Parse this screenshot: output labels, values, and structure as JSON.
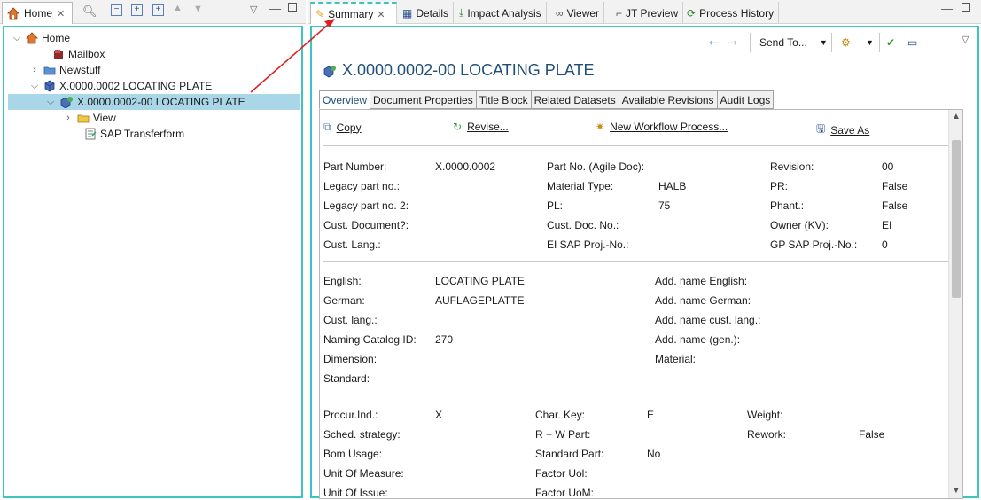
{
  "left_panel": {
    "tab_label": "Home",
    "tree": [
      {
        "label": "Home"
      },
      {
        "label": "Mailbox"
      },
      {
        "label": "Newstuff"
      },
      {
        "label": "X.0000.0002 LOCATING PLATE"
      },
      {
        "label": "X.0000.0002-00 LOCATING PLATE"
      },
      {
        "label": "View"
      },
      {
        "label": "SAP Transferform"
      }
    ]
  },
  "right_panel": {
    "tabs": [
      "Summary",
      "Details",
      "Impact Analysis",
      "Viewer",
      "JT Preview",
      "Process History"
    ],
    "toolbar": {
      "send_to": "Send To..."
    },
    "title": "X.0000.0002-00 LOCATING PLATE",
    "subtabs": [
      "Overview",
      "Document Properties",
      "Title Block",
      "Related Datasets",
      "Available Revisions",
      "Audit Logs"
    ],
    "actions": {
      "copy": "Copy",
      "revise": "Revise...",
      "workflow": "New Workflow Process...",
      "save_as": "Save As"
    },
    "section1": {
      "part_number_label": "Part Number:",
      "part_number_value": "X.0000.0002",
      "part_no_agile_label": "Part No. (Agile Doc):",
      "revision_label": "Revision:",
      "revision_value": "00",
      "legacy_label": "Legacy part no.:",
      "material_type_label": "Material Type:",
      "material_type_value": "HALB",
      "pr_label": "PR:",
      "pr_value": "False",
      "legacy2_label": "Legacy part no. 2:",
      "pl_label": "PL:",
      "pl_value": "75",
      "phant_label": "Phant.:",
      "phant_value": "False",
      "cust_doc_label": "Cust. Document?:",
      "cust_doc_no_label": "Cust. Doc. No.:",
      "owner_label": "Owner (KV):",
      "owner_value": "EI",
      "cust_lang_label": "Cust. Lang.:",
      "ei_sap_label": "EI SAP Proj.-No.:",
      "gp_sap_label": "GP SAP Proj.-No.:",
      "gp_sap_value": "0"
    },
    "section2": {
      "english_label": "English:",
      "english_value": "LOCATING PLATE",
      "add_english_label": "Add. name English:",
      "german_label": "German:",
      "german_value": "AUFLAGEPLATTE",
      "add_german_label": "Add. name German:",
      "cust_lang_label": "Cust. lang.:",
      "add_cust_lang_label": "Add. name cust. lang.:",
      "naming_label": "Naming Catalog ID:",
      "naming_value": "270",
      "add_gen_label": "Add. name (gen.):",
      "dimension_label": "Dimension:",
      "material_label": "Material:",
      "standard_label": "Standard:"
    },
    "section3": {
      "procur_label": "Procur.Ind.:",
      "procur_value": "X",
      "char_key_label": "Char. Key:",
      "char_key_value": "E",
      "weight_label": "Weight:",
      "sched_label": "Sched. strategy:",
      "rw_label": "R + W Part:",
      "rework_label": "Rework:",
      "rework_value": "False",
      "bom_label": "Bom Usage:",
      "std_part_label": "Standard Part:",
      "std_part_value": "No",
      "uom_label": "Unit Of Measure:",
      "factor_uol_label": "Factor Uol:",
      "uoi_label": "Unit Of Issue:",
      "factor_uom_label": "Factor UoM:"
    }
  },
  "colors": {
    "focus_border": "#3cc4c0",
    "selection": "#a9d7e8",
    "title": "#1f4e79",
    "annotation_arrow": "#e02020"
  }
}
